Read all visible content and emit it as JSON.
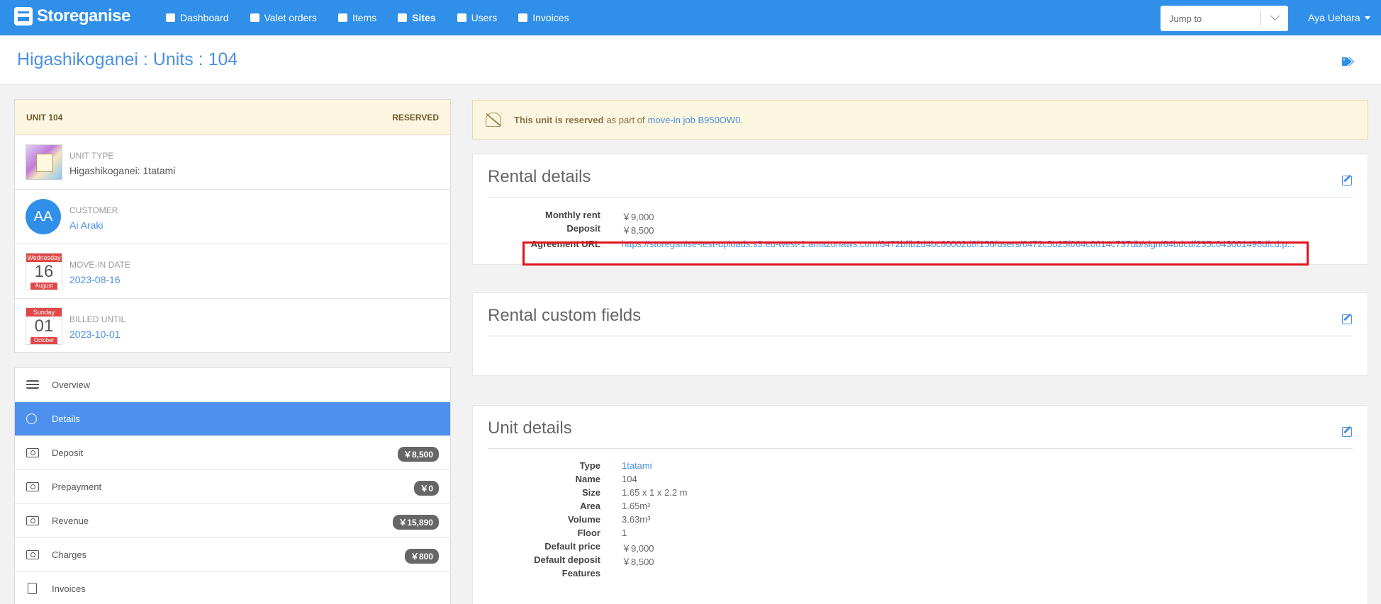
{
  "nav": {
    "brand": "Storeganise",
    "links": [
      {
        "label": "Dashboard"
      },
      {
        "label": "Valet orders"
      },
      {
        "label": "Items"
      },
      {
        "label": "Sites"
      },
      {
        "label": "Users"
      },
      {
        "label": "Invoices"
      }
    ],
    "jump_to": "Jump to",
    "user": "Aya Uehara"
  },
  "page_title": "Higashikoganei : Units : 104",
  "unit": {
    "label": "UNIT 104",
    "status": "RESERVED",
    "unit_type_label": "UNIT TYPE",
    "unit_type": "Higashikoganei: 1tatami",
    "customer_label": "CUSTOMER",
    "customer_initials": "AA",
    "customer": "Ai Araki",
    "move_in_label": "MOVE-IN DATE",
    "move_in_weekday": "Wednesday",
    "move_in_day": "16",
    "move_in_month": "August",
    "move_in_date": "2023-08-16",
    "billed_label": "BILLED UNTIL",
    "billed_weekday": "Sunday",
    "billed_day": "01",
    "billed_month": "October",
    "billed_date": "2023-10-01"
  },
  "menu": [
    {
      "label": "Overview",
      "icon": "checklist-icon"
    },
    {
      "label": "Details",
      "icon": "info-icon"
    },
    {
      "label": "Deposit",
      "icon": "cash-icon",
      "badge": "￥8,500"
    },
    {
      "label": "Prepayment",
      "icon": "cash-icon",
      "badge": "￥0"
    },
    {
      "label": "Revenue",
      "icon": "cash-icon",
      "badge": "￥15,890"
    },
    {
      "label": "Charges",
      "icon": "cash-icon",
      "badge": "￥800"
    },
    {
      "label": "Invoices",
      "icon": "invoice-icon"
    }
  ],
  "alert": {
    "bold": "This unit is reserved",
    "text": "as part of",
    "link": "move-in job B950OW0",
    "end": "."
  },
  "rental_details": {
    "title": "Rental details",
    "monthly_rent_label": "Monthly rent",
    "monthly_rent": "￥9,000",
    "deposit_label": "Deposit",
    "deposit": "￥8,500",
    "agreement_label": "Agreement URL",
    "agreement_url": "https://storeganise-test-uploads.s3.eu-west-1.amazonaws.com/6472bffb2d4bc80002d8f156/users/6472c5b25f064c0014c737db/sign/64bdcdf235c043001498dfcd.p..."
  },
  "rental_custom_fields": {
    "title": "Rental custom fields"
  },
  "unit_details": {
    "title": "Unit details",
    "rows": [
      {
        "k": "Type",
        "v": "1tatami",
        "link": true
      },
      {
        "k": "Name",
        "v": "104"
      },
      {
        "k": "Size",
        "v": "1.65 x 1 x 2.2 m"
      },
      {
        "k": "Area",
        "v": "1.65m²"
      },
      {
        "k": "Volume",
        "v": "3.63m³"
      },
      {
        "k": "Floor",
        "v": "1"
      },
      {
        "k": "Default price",
        "v": "￥9,000"
      },
      {
        "k": "Default deposit",
        "v": "￥8,500"
      },
      {
        "k": "Features",
        "v": ""
      }
    ]
  }
}
